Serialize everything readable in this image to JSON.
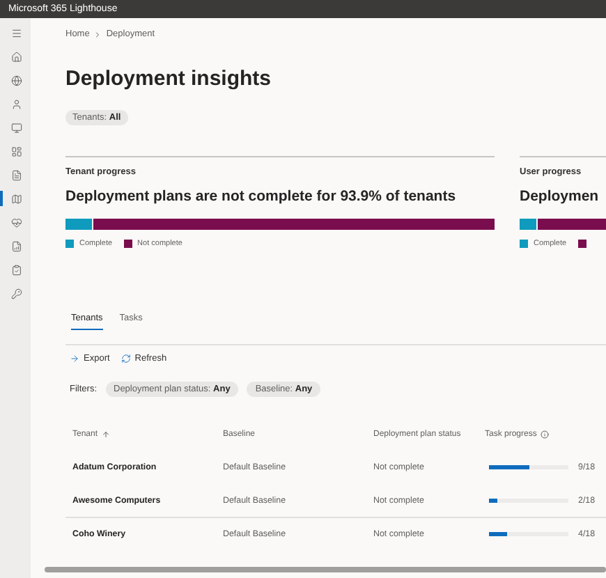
{
  "app_bar": {
    "title": "Microsoft 365 Lighthouse"
  },
  "sidebar": {
    "items": [
      {
        "kind": "menu",
        "selected": false
      },
      {
        "kind": "home",
        "selected": false
      },
      {
        "kind": "globe",
        "selected": false
      },
      {
        "kind": "user",
        "selected": false
      },
      {
        "kind": "monitor",
        "selected": false
      },
      {
        "kind": "dashboard",
        "selected": false
      },
      {
        "kind": "document",
        "selected": false
      },
      {
        "kind": "map",
        "selected": true
      },
      {
        "kind": "heart",
        "selected": false
      },
      {
        "kind": "report",
        "selected": false
      },
      {
        "kind": "clipboard",
        "selected": false
      },
      {
        "kind": "key",
        "selected": false
      }
    ]
  },
  "breadcrumb": [
    "Home",
    "Deployment"
  ],
  "title": "Deployment insights",
  "scope_chip": {
    "label": "Tenants:",
    "value": "All"
  },
  "cards": [
    {
      "label": "Tenant progress",
      "heading": "Deployment plans are not complete for 93.9% of tenants",
      "level": 0.061,
      "legend": [
        {
          "label": "Complete",
          "color": "#0f9bbd"
        },
        {
          "label": "Not complete",
          "color": "#7a0d4d"
        }
      ]
    },
    {
      "label": "User progress",
      "heading": "Deploymen",
      "level": 0.04,
      "legend": [
        {
          "label": "Complete",
          "color": "#0f9bbd"
        },
        {
          "color": "#7a0d4d"
        }
      ]
    }
  ],
  "tabs": [
    {
      "label": "Tenants",
      "selected": true
    },
    {
      "label": "Tasks",
      "selected": false
    }
  ],
  "toolbar": [
    {
      "kind": "export",
      "label": "Export"
    },
    {
      "kind": "refresh",
      "label": "Refresh"
    }
  ],
  "filters": {
    "label": "Filters:",
    "chips": [
      {
        "label": "Deployment plan status:",
        "value": "Any"
      },
      {
        "label": "Baseline:",
        "value": "Any"
      }
    ]
  },
  "table": {
    "columns": [
      "Tenant",
      "Baseline",
      "Deployment plan status",
      "Task progress"
    ],
    "rows": [
      {
        "tenant": "Adatum Corporation",
        "baseline": "Default Baseline",
        "status": "Not complete",
        "level": 0.5,
        "progress": "9/18"
      },
      {
        "tenant": "Awesome Computers",
        "baseline": "Default Baseline",
        "status": "Not complete",
        "level": 0.11,
        "progress": "2/18"
      },
      {
        "tenant": "Coho Winery",
        "baseline": "Default Baseline",
        "status": "Not complete",
        "level": 0.22,
        "progress": "4/18"
      }
    ]
  }
}
